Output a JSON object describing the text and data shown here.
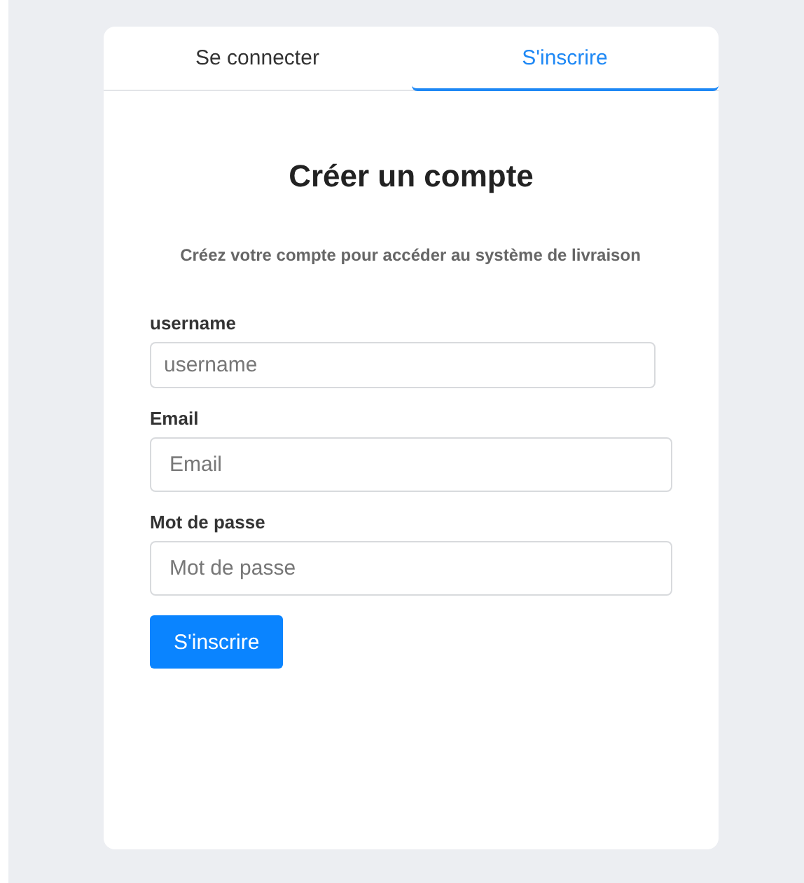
{
  "tabs": [
    {
      "label": "Se connecter",
      "selected": false
    },
    {
      "label": "S'inscrire",
      "selected": true
    }
  ],
  "title": "Créer un compte",
  "subtitle": "Créez votre compte pour accéder au système de livraison",
  "fields": [
    {
      "label": "username",
      "placeholder": "username"
    },
    {
      "label": "Email",
      "placeholder": "Email"
    },
    {
      "label": "Mot de passe",
      "placeholder": "Mot de passe"
    }
  ],
  "submit": "S'inscrire"
}
